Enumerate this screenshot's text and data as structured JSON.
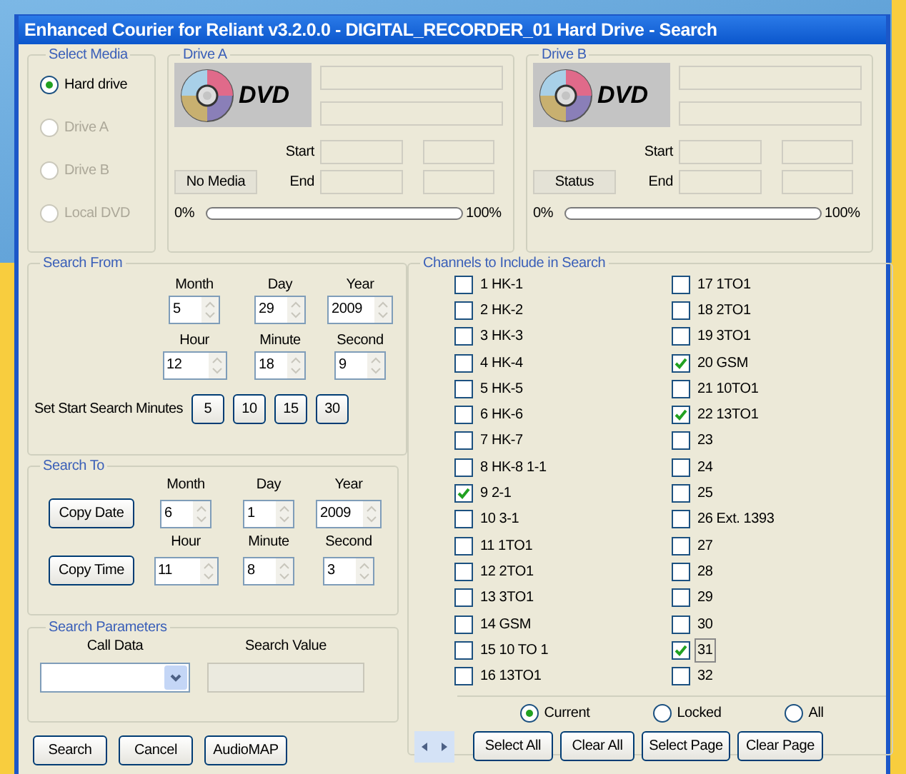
{
  "window": {
    "title": "Enhanced Courier for Reliant v3.2.0.0 - DIGITAL_RECORDER_01 Hard Drive - Search"
  },
  "select_media": {
    "label": "Select Media",
    "options": [
      {
        "label": "Hard drive",
        "selected": true,
        "disabled": false
      },
      {
        "label": "Drive A",
        "selected": false,
        "disabled": true
      },
      {
        "label": "Drive B",
        "selected": false,
        "disabled": true
      },
      {
        "label": "Local DVD",
        "selected": false,
        "disabled": true
      }
    ]
  },
  "drives": [
    {
      "label": "Drive A",
      "logo_text": "DVD",
      "status": "No Media",
      "start_label": "Start",
      "end_label": "End",
      "progress_min": "0%",
      "progress_max": "100%",
      "level": 0
    },
    {
      "label": "Drive B",
      "logo_text": "DVD",
      "status": "Status",
      "start_label": "Start",
      "end_label": "End",
      "progress_min": "0%",
      "progress_max": "100%",
      "level": 0
    }
  ],
  "search_from": {
    "label": "Search From",
    "fields": [
      {
        "label": "Month",
        "value": "5"
      },
      {
        "label": "Day",
        "value": "29"
      },
      {
        "label": "Year",
        "value": "2009"
      },
      {
        "label": "Hour",
        "value": "12"
      },
      {
        "label": "Minute",
        "value": "18"
      },
      {
        "label": "Second",
        "value": "9"
      }
    ],
    "minutes_label": "Set Start Search Minutes",
    "minute_buttons": [
      "5",
      "10",
      "15",
      "30"
    ]
  },
  "search_to": {
    "label": "Search To",
    "copy_date": "Copy Date",
    "copy_time": "Copy Time",
    "fields": [
      {
        "label": "Month",
        "value": "6"
      },
      {
        "label": "Day",
        "value": "1"
      },
      {
        "label": "Year",
        "value": "2009"
      },
      {
        "label": "Hour",
        "value": "11"
      },
      {
        "label": "Minute",
        "value": "8"
      },
      {
        "label": "Second",
        "value": "3"
      }
    ]
  },
  "search_parameters": {
    "label": "Search Parameters",
    "call_data_label": "Call Data",
    "search_value_label": "Search Value"
  },
  "buttons": [
    "Search",
    "Cancel",
    "AudioMAP"
  ],
  "channels": {
    "label": "Channels to Include in Search",
    "items": [
      {
        "label": "1 HK-1",
        "checked": false,
        "focused": false
      },
      {
        "label": "2 HK-2",
        "checked": false,
        "focused": false
      },
      {
        "label": "3 HK-3",
        "checked": false,
        "focused": false
      },
      {
        "label": "4 HK-4",
        "checked": false,
        "focused": false
      },
      {
        "label": "5 HK-5",
        "checked": false,
        "focused": false
      },
      {
        "label": "6 HK-6",
        "checked": false,
        "focused": false
      },
      {
        "label": "7 HK-7",
        "checked": false,
        "focused": false
      },
      {
        "label": "8 HK-8 1-1",
        "checked": false,
        "focused": false
      },
      {
        "label": "9 2-1",
        "checked": true,
        "focused": false
      },
      {
        "label": "10 3-1",
        "checked": false,
        "focused": false
      },
      {
        "label": "11 1TO1",
        "checked": false,
        "focused": false
      },
      {
        "label": "12 2TO1",
        "checked": false,
        "focused": false
      },
      {
        "label": "13 3TO1",
        "checked": false,
        "focused": false
      },
      {
        "label": "14 GSM",
        "checked": false,
        "focused": false
      },
      {
        "label": "15 10 TO 1",
        "checked": false,
        "focused": false
      },
      {
        "label": "16 13TO1",
        "checked": false,
        "focused": false
      },
      {
        "label": "17 1TO1",
        "checked": false,
        "focused": false
      },
      {
        "label": "18 2TO1",
        "checked": false,
        "focused": false
      },
      {
        "label": "19 3TO1",
        "checked": false,
        "focused": false
      },
      {
        "label": "20 GSM",
        "checked": true,
        "focused": false
      },
      {
        "label": "21 10TO1",
        "checked": false,
        "focused": false
      },
      {
        "label": "22 13TO1",
        "checked": true,
        "focused": false
      },
      {
        "label": "23",
        "checked": false,
        "focused": false
      },
      {
        "label": "24",
        "checked": false,
        "focused": false
      },
      {
        "label": "25",
        "checked": false,
        "focused": false
      },
      {
        "label": "26 Ext. 1393",
        "checked": false,
        "focused": false
      },
      {
        "label": "27",
        "checked": false,
        "focused": false
      },
      {
        "label": "28",
        "checked": false,
        "focused": false
      },
      {
        "label": "29",
        "checked": false,
        "focused": false
      },
      {
        "label": "30",
        "checked": false,
        "focused": false
      },
      {
        "label": "31",
        "checked": true,
        "focused": true
      },
      {
        "label": "32",
        "checked": false,
        "focused": false
      }
    ],
    "scope": [
      {
        "label": "Current",
        "selected": true
      },
      {
        "label": "Locked",
        "selected": false
      },
      {
        "label": "All",
        "selected": false
      }
    ],
    "buttons": [
      "Select All",
      "Clear All",
      "Select Page",
      "Clear Page"
    ]
  }
}
